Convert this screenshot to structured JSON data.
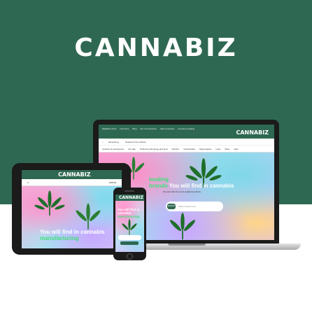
{
  "brand": {
    "name": "CANNABIZ",
    "primary_color": "#2f6852",
    "accent_color": "#3fe07a"
  },
  "laptop": {
    "top_links": [
      "Eligibility check",
      "Find Here",
      "Blog",
      "My next business",
      "Add a business",
      "Inventory heading"
    ],
    "brand": "CANNABIZ",
    "util_left": "advertising",
    "util_middle": "Needed in the industry",
    "menu": [
      "products & accessories",
      "For sale",
      "Products technology and food",
      "Doctors",
      "merchandise",
      "Dispensaries",
      "Laws",
      "More",
      "Jobs"
    ],
    "headline_accent": "leading",
    "headline_accent2": "brands",
    "headline_main": "You will find in cannabis",
    "subheadline": "We also offer the most updated products",
    "search_button": "SEARCH",
    "search_placeholder": "Search name here..."
  },
  "tablet": {
    "brand": "CANNABIZ",
    "bar_left": "⌕",
    "bar_right": "menu",
    "headline_main": "You will find in cannabis",
    "headline_accent": "manufacturing"
  },
  "phone": {
    "brand": "CANNABIZ",
    "headline_main": "You will find in cannabis",
    "headline_accent": "manufacturing"
  }
}
